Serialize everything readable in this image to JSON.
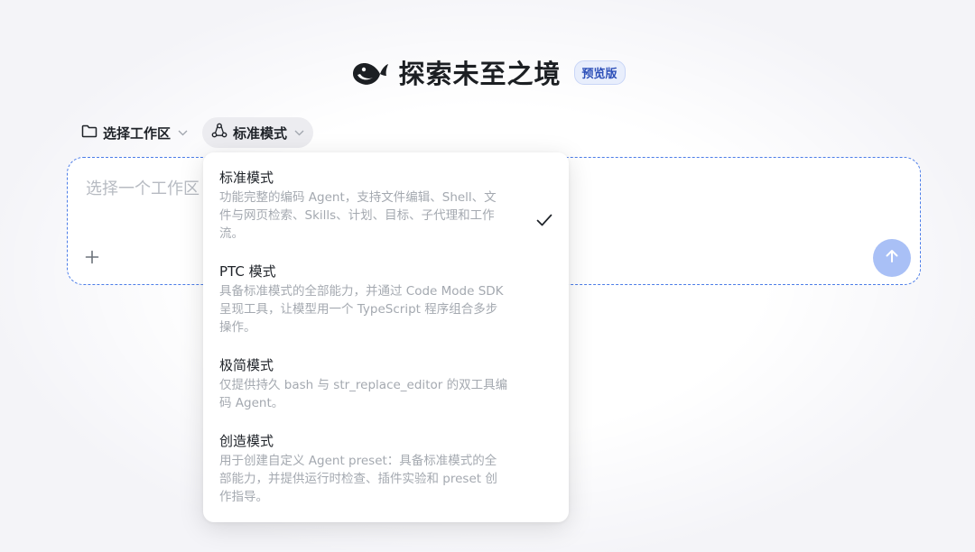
{
  "hero": {
    "title": "探索未至之境",
    "badge": "预览版"
  },
  "toolbar": {
    "workspace_label": "选择工作区",
    "mode_label": "标准模式"
  },
  "input": {
    "placeholder": "选择一个工作区"
  },
  "modes": [
    {
      "name": "标准模式",
      "desc_lines": [
        "功能完整的编码 Agent，支持文件编辑、Shell、文",
        "件与网页检索、Skills、计划、目标、子代理和工作",
        "流。"
      ],
      "selected": true
    },
    {
      "name": "PTC 模式",
      "desc_lines": [
        "具备标准模式的全部能力，并通过 Code Mode SDK",
        "呈现工具，让模型用一个 TypeScript 程序组合多步",
        "操作。"
      ],
      "selected": false
    },
    {
      "name": "极简模式",
      "desc_lines": [
        "仅提供持久 bash 与 str_replace_editor 的双工具编",
        "码 Agent。"
      ],
      "selected": false
    },
    {
      "name": "创造模式",
      "desc_lines": [
        "用于创建自定义 Agent preset：具备标准模式的全",
        "部能力，并提供运行时检查、插件实验和 preset 创",
        "作指导。"
      ],
      "selected": false
    }
  ],
  "icons": {
    "logo": "whale-logo-icon",
    "folder": "folder-icon",
    "mode": "mode-cycle-icon",
    "chevron": "chevron-down-icon",
    "add": "plus-icon",
    "send": "arrow-up-icon",
    "check": "check-icon"
  },
  "colors": {
    "accent": "#4c7de8",
    "send_button": "#a9c0f6",
    "badge_bg": "#e8eefc",
    "badge_text": "#2c4fb8"
  }
}
